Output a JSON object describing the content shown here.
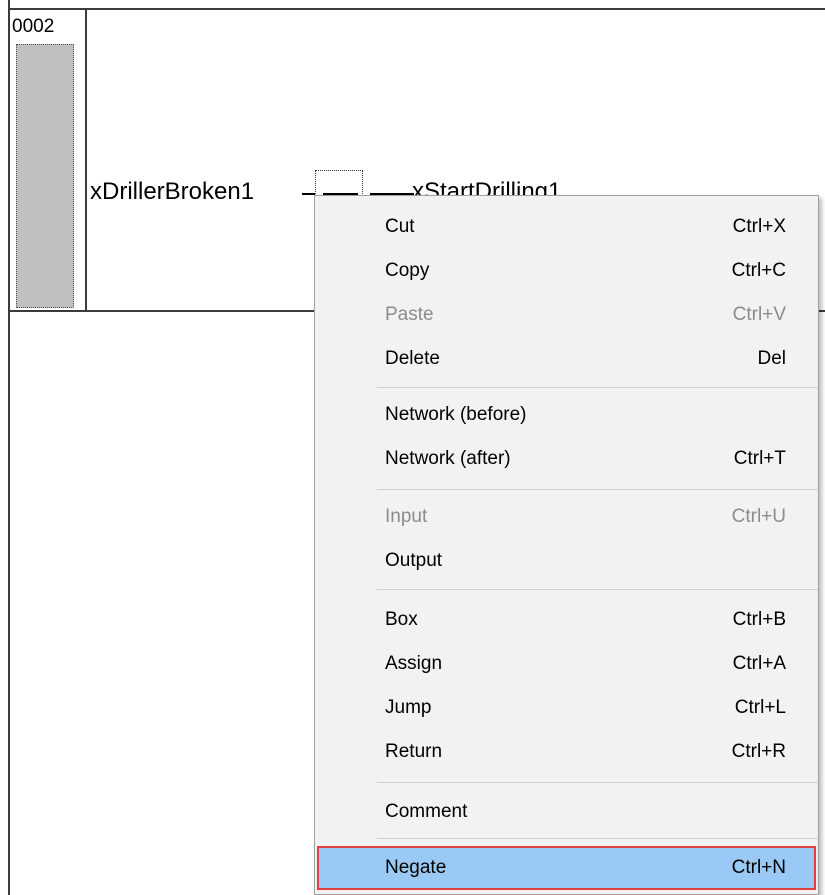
{
  "network": {
    "number": "0002",
    "input_variable": "xDrillerBroken1",
    "output_variable": "xStartDrilling1"
  },
  "context_menu": {
    "items": [
      {
        "label": "Cut",
        "shortcut": "Ctrl+X",
        "enabled": true
      },
      {
        "label": "Copy",
        "shortcut": "Ctrl+C",
        "enabled": true
      },
      {
        "label": "Paste",
        "shortcut": "Ctrl+V",
        "enabled": false
      },
      {
        "label": "Delete",
        "shortcut": "Del",
        "enabled": true
      },
      {
        "label": "Network (before)",
        "shortcut": "",
        "enabled": true
      },
      {
        "label": "Network (after)",
        "shortcut": "Ctrl+T",
        "enabled": true
      },
      {
        "label": "Input",
        "shortcut": "Ctrl+U",
        "enabled": false
      },
      {
        "label": "Output",
        "shortcut": "",
        "enabled": true
      },
      {
        "label": "Box",
        "shortcut": "Ctrl+B",
        "enabled": true
      },
      {
        "label": "Assign",
        "shortcut": "Ctrl+A",
        "enabled": true
      },
      {
        "label": "Jump",
        "shortcut": "Ctrl+L",
        "enabled": true
      },
      {
        "label": "Return",
        "shortcut": "Ctrl+R",
        "enabled": true
      },
      {
        "label": "Comment",
        "shortcut": "",
        "enabled": true
      },
      {
        "label": "Negate",
        "shortcut": "Ctrl+N",
        "enabled": true,
        "highlighted": true
      }
    ]
  },
  "colors": {
    "menu_background": "#f2f2f2",
    "highlight": "#99c9f4",
    "highlight_border": "#e04040",
    "disabled_text": "#8c8c8c",
    "gutter": "#c0c0c0"
  }
}
